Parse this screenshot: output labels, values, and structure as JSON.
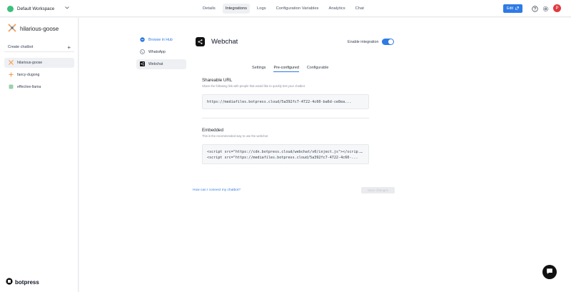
{
  "workspace": {
    "name": "Default Workspace"
  },
  "nav": {
    "tabs": [
      {
        "label": "Details",
        "active": false
      },
      {
        "label": "Integrations",
        "active": true
      },
      {
        "label": "Logs",
        "active": false
      },
      {
        "label": "Configuration Variables",
        "active": false
      },
      {
        "label": "Analytics",
        "active": false
      },
      {
        "label": "Chat",
        "active": false
      }
    ],
    "edit_label": "Edit",
    "avatar_initial": "P"
  },
  "sidebar": {
    "bot_title": "hilarious-goose",
    "create_label": "Create chatbot",
    "bots": [
      {
        "label": "hilarious-goose",
        "active": true
      },
      {
        "label": "fancy-dugong",
        "active": false
      },
      {
        "label": "effective-llama",
        "active": false
      }
    ],
    "logo_text": "botpress"
  },
  "integrations": {
    "items": [
      {
        "label": "Browse in Hub"
      },
      {
        "label": "WhatsApp"
      },
      {
        "label": "Webchat"
      }
    ]
  },
  "webchat": {
    "title": "Webchat",
    "enable_label": "Enable integration",
    "enabled": true,
    "sub_tabs": [
      "Settings",
      "Pre-configured",
      "Configurable"
    ],
    "active_sub_tab": "Pre-configured",
    "shareable": {
      "title": "Shareable URL",
      "description": "Share the following link with people that would like to quickly test your chatbot",
      "url": "https://mediafiles.botpress.cloud/5a392fc7-4722-4c60-ba6d-ce8ea..."
    },
    "embedded": {
      "title": "Embedded",
      "description": "This is the recommended way to use the webchat",
      "line1": "<script src=\"https://cdn.botpress.cloud/webchat/v0/inject.js\"></scrip...",
      "line2": "<script src=\"https://mediafiles.botpress.cloud/5a392fc7-4722-4c60-..."
    },
    "help_link": "How can I connect my chatbot?",
    "save_label": "Save Changes"
  },
  "colors": {
    "accent": "#2f7ae5",
    "workspace_dot": "#3dbf7d",
    "avatar": "#e0393e"
  }
}
